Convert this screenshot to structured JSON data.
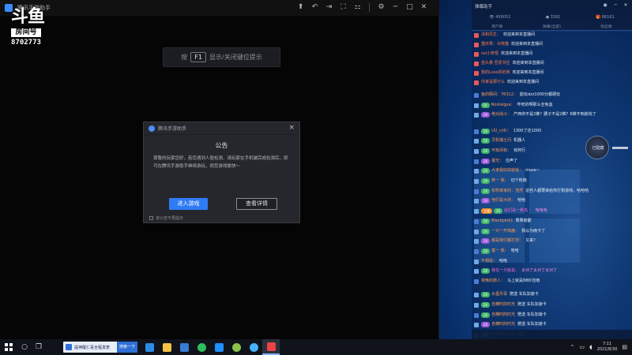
{
  "emulator": {
    "title": "腾讯手游助手",
    "tools": [
      "⬆",
      "↶",
      "⇥",
      "⛶",
      "⚏",
      "⚙",
      "─",
      "□",
      "✕"
    ],
    "f1_hint": {
      "prefix": "按",
      "key": "F1",
      "suffix": "显示/关闭键位提示"
    }
  },
  "douyu": {
    "brand": "斗鱼",
    "label": "房间号",
    "room": "8702773"
  },
  "dialog": {
    "app_name": "腾讯手游助手",
    "close": "×",
    "title": "公告",
    "body": "尊敬的玩家您好，若您遇到人脸检测、请玩家在手机端完成检测后，即可在腾讯手游助手继续游玩，祝您游戏愉快～",
    "enter_button": "进入游戏",
    "details_button": "查看详情",
    "checkbox_label": "该公告不再提示"
  },
  "chat": {
    "title": "弹幕助手",
    "controls": [
      "◉",
      "─",
      "✕"
    ],
    "stats": [
      "👁 458052",
      "◼ 3391",
      "🎁 86161"
    ],
    "tabs": [
      "用户数",
      "弹幕(全部)",
      "粉丝数"
    ],
    "rows": [
      {
        "badge": "",
        "lvl": "",
        "user": "清和风生：",
        "msg": "欢迎来到本直播间",
        "uc": "#ff7b4a"
      },
      {
        "badge": "",
        "lvl": "",
        "user": "重庆果：ゆ熊猫",
        "msg": "欢迎来到本直播间",
        "uc": "#ff7b4a"
      },
      {
        "badge": "",
        "lvl": "",
        "user": "sel小奇怪",
        "msg": "欢迎来到本直播间",
        "uc": "#ff7b4a"
      },
      {
        "badge": "",
        "lvl": "",
        "user": "苗头着·吾爱书生",
        "msg": "欢迎来到本直播间",
        "uc": "#ff7b4a"
      },
      {
        "badge": "",
        "lvl": "",
        "user": "我的Lose的的我",
        "msg": "欢迎来到本直播间",
        "uc": "#ff7b4a"
      },
      {
        "badge": "",
        "lvl": "",
        "user": "你家是那什么",
        "msg": "欢迎来到本直播间",
        "uc": "#ff7b4a"
      },
      {
        "badge": "",
        "lvl": "",
        "user": "鱼的瞬间：76312：",
        "msg": "能玩dzz1000分都硬玩",
        "uc": "#ff9b55"
      },
      {
        "badge": "",
        "lvl": "LV",
        "user": "Nostalgya：",
        "msg": "咋死的啊那么全免血",
        "uc": "#ff9b55"
      },
      {
        "badge": "",
        "lvl": "20",
        "user": "绝对战斗：",
        "msg": "产西你不是2推？腰子不是2推？6推不到航线了",
        "uc": "#ff9b55"
      },
      {
        "badge": "",
        "lvl": "20",
        "user": "UU_c(4)：",
        "msg": "1300了还1000",
        "uc": "#ff9b55"
      },
      {
        "badge": "",
        "lvl": "20",
        "user": "灵机瑞士闪",
        "msg": "机器人",
        "uc": "#ff9b55"
      },
      {
        "badge": "",
        "lvl": "20",
        "user": "可有闲有：",
        "msg": "有阿行",
        "uc": "#ff9b55"
      },
      {
        "badge": "",
        "lvl": "20",
        "user": "童无：",
        "msg": "应声了",
        "uc": "#ff9b55"
      },
      {
        "badge": "",
        "lvl": "20",
        "user": "大家我好的就饭：",
        "msg": "muse~",
        "uc": "#ff9b55"
      },
      {
        "badge": "",
        "lvl": "20",
        "user": "蒋一 我：",
        "msg": "切个枪跑",
        "uc": "#ff9b55"
      },
      {
        "badge": "",
        "lvl": "20",
        "user": "松牧家家的：浩然",
        "msg": "这些人都要来给你打狗道线，哈哈哈",
        "uc": "#ff9b55"
      },
      {
        "badge": "",
        "lvl": "20",
        "user": "他们是大的：",
        "msg": "哈哈",
        "uc": "#ff9b55"
      },
      {
        "badge": "主播",
        "lvl": "20",
        "user": "此们是一枪鸟 ：",
        "msg": "哈哈哈",
        "uc": "#ff6ad5"
      },
      {
        "badge": "",
        "lvl": "20",
        "user": "Blackpink1",
        "msg": "果果者都",
        "uc": "#ff9b55"
      },
      {
        "badge": "",
        "lvl": "20",
        "user": "一只一开高鹿：",
        "msg": "我以为雨卡了",
        "uc": "#ff9b55"
      },
      {
        "badge": "",
        "lvl": "20",
        "user": "都是我们都打扮：",
        "msg": "又来？",
        "uc": "#ff9b55"
      },
      {
        "badge": "",
        "lvl": "20",
        "user": "童一 我：",
        "msg": "哈哈",
        "uc": "#ff9b55"
      },
      {
        "badge": "",
        "lvl": "",
        "user": "不相信：",
        "msg": "哈哈",
        "uc": "#ff9b55"
      },
      {
        "badge": "",
        "lvl": "20",
        "user": "我在一只就是：",
        "msg": "太对了太对了太对了",
        "uc": "#ff6ad5"
      },
      {
        "badge": "",
        "lvl": "",
        "user": "夜晚的旅人：",
        "msg": "马上就是88红包雨",
        "uc": "#ff9b55"
      },
      {
        "badge": "",
        "lvl": "20",
        "user": "水墨丹青",
        "msg": "赠送 车队加速卡",
        "uc": "#ff9b55"
      },
      {
        "badge": "",
        "lvl": "20",
        "user": "自横时的时光",
        "msg": "赠送 车队加速卡",
        "uc": "#ff9b55"
      },
      {
        "badge": "",
        "lvl": "20",
        "user": "自横时的时光",
        "msg": "赠送 车队加速卡",
        "uc": "#ff9b55"
      },
      {
        "badge": "",
        "lvl": "20",
        "user": "自横时的时光",
        "msg": "赠送 车队加速卡",
        "uc": "#ff9b55"
      },
      {
        "badge": "",
        "lvl": "20",
        "user": "自横时的时光",
        "msg": "赠送",
        "uc": "#ff9b55"
      }
    ]
  },
  "float_ball": {
    "label": "已隐藏"
  },
  "taskbar": {
    "search_text": "提神醒仁喜全程发表",
    "search_button": "搜索一下",
    "apps": [
      {
        "name": "edge-icon",
        "color": "#2b8ce8"
      },
      {
        "name": "folder-icon",
        "color": "#f5c242"
      },
      {
        "name": "store-icon",
        "color": "#3a7bd5"
      },
      {
        "name": "chat-app-icon",
        "color": "#2fbf5b"
      },
      {
        "name": "blue-app-icon",
        "color": "#1e90ff"
      },
      {
        "name": "game-app-icon",
        "color": "#8bc34a"
      },
      {
        "name": "browser-app-icon",
        "color": "#46b3ff"
      },
      {
        "name": "red-app-icon",
        "color": "#e94343"
      }
    ],
    "time": "7:11",
    "date": "2021/8/30"
  }
}
